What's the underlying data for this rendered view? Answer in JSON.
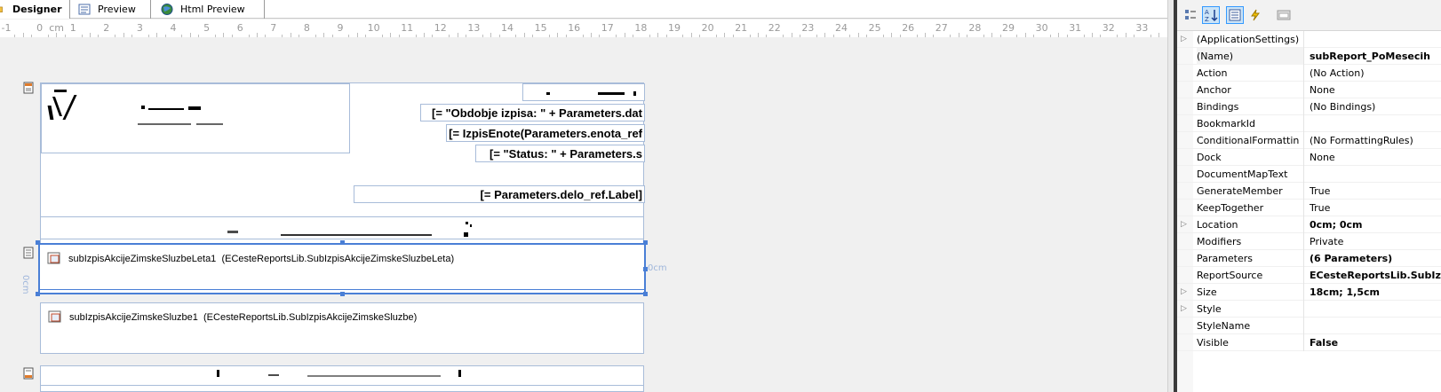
{
  "tabs": [
    {
      "label": "Designer",
      "active": true,
      "icon": "designer-icon"
    },
    {
      "label": "Preview",
      "active": false,
      "icon": "preview-icon"
    },
    {
      "label": "Html Preview",
      "active": false,
      "icon": "globe-icon"
    }
  ],
  "ruler": {
    "unit": "cm",
    "ticks": [
      "-1",
      "0",
      "1",
      "2",
      "3",
      "4",
      "5",
      "6",
      "7",
      "8",
      "9",
      "10",
      "11",
      "12",
      "13",
      "14",
      "15",
      "16",
      "17",
      "18",
      "19",
      "20",
      "21",
      "22",
      "23",
      "24",
      "25",
      "26",
      "27",
      "28",
      "29",
      "30",
      "31",
      "32",
      "33"
    ]
  },
  "report": {
    "header_fields": [
      "[= \"Obdobje izpisa: \" + Parameters.dat",
      "[= IzpisEnote(Parameters.enota_ref",
      "[= \"Status: \" + Parameters.s",
      "[= Parameters.delo_ref.Label]"
    ],
    "subreports": [
      {
        "name": "subIzpisAkcijeZimskeSluzbeLeta1",
        "type": "(ECesteReportsLib.SubIzpisAkcijeZimskeSluzbeLeta)"
      },
      {
        "name": "subIzpisAkcijeZimskeSluzbe1",
        "type": "(ECesteReportsLib.SubIzpisAkcijeZimskeSluzbe)"
      }
    ],
    "selection_label_right": "0cm",
    "selection_label_left": "0cm"
  },
  "properties": {
    "rows": [
      {
        "name": "(ApplicationSettings)",
        "value": "",
        "expandable": true,
        "bold": false
      },
      {
        "name": "(Name)",
        "value": "subReport_PoMesecih",
        "expandable": false,
        "bold": true
      },
      {
        "name": "Action",
        "value": "(No Action)",
        "expandable": false,
        "bold": false
      },
      {
        "name": "Anchor",
        "value": "None",
        "expandable": false,
        "bold": false
      },
      {
        "name": "Bindings",
        "value": "(No Bindings)",
        "expandable": false,
        "bold": false
      },
      {
        "name": "BookmarkId",
        "value": "",
        "expandable": false,
        "bold": false
      },
      {
        "name": "ConditionalFormattin",
        "value": "(No FormattingRules)",
        "expandable": false,
        "bold": false
      },
      {
        "name": "Dock",
        "value": "None",
        "expandable": false,
        "bold": false
      },
      {
        "name": "DocumentMapText",
        "value": "",
        "expandable": false,
        "bold": false
      },
      {
        "name": "GenerateMember",
        "value": "True",
        "expandable": false,
        "bold": false
      },
      {
        "name": "KeepTogether",
        "value": "True",
        "expandable": false,
        "bold": false
      },
      {
        "name": "Location",
        "value": "0cm; 0cm",
        "expandable": true,
        "bold": true
      },
      {
        "name": "Modifiers",
        "value": "Private",
        "expandable": false,
        "bold": false
      },
      {
        "name": "Parameters",
        "value": "(6 Parameters)",
        "expandable": false,
        "bold": true
      },
      {
        "name": "ReportSource",
        "value": "ECesteReportsLib.SubIzpisA",
        "expandable": false,
        "bold": true
      },
      {
        "name": "Size",
        "value": "18cm; 1,5cm",
        "expandable": true,
        "bold": true
      },
      {
        "name": "Style",
        "value": "",
        "expandable": true,
        "bold": false
      },
      {
        "name": "StyleName",
        "value": "",
        "expandable": false,
        "bold": false
      },
      {
        "name": "Visible",
        "value": "False",
        "expandable": false,
        "bold": true
      }
    ]
  },
  "colors": {
    "selection": "#4a7fd6",
    "band_border": "#a8bcd9",
    "designer_bg": "#f0f0f0"
  }
}
